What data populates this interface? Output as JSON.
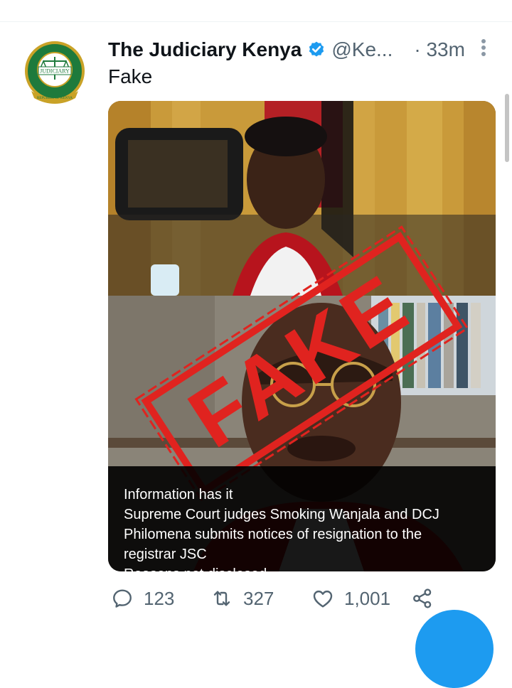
{
  "tweet": {
    "author_name": "The Judiciary Kenya",
    "handle": "@Ke...",
    "time": "· 33m",
    "text": "Fake",
    "avatar": {
      "top_text": "JUDICIARY",
      "bottom_text": "REPUBLIC OF KENYA"
    },
    "verified_icon": "verified-badge-icon"
  },
  "media": {
    "stamp_text": "FAKE",
    "caption_lines": [
      "Information has it",
      "Supreme Court judges Smoking Wanjala and DCJ",
      "Philomena submits notices of resignation to the",
      "registrar JSC",
      "Reasons not disclosed."
    ]
  },
  "actions": {
    "replies": "123",
    "retweets": "327",
    "likes": "1,001",
    "icons": [
      "reply-icon",
      "retweet-icon",
      "like-icon",
      "share-icon"
    ]
  },
  "colors": {
    "accent": "#1d9bf0",
    "stamp": "#e0231f",
    "muted_text": "#536471"
  }
}
